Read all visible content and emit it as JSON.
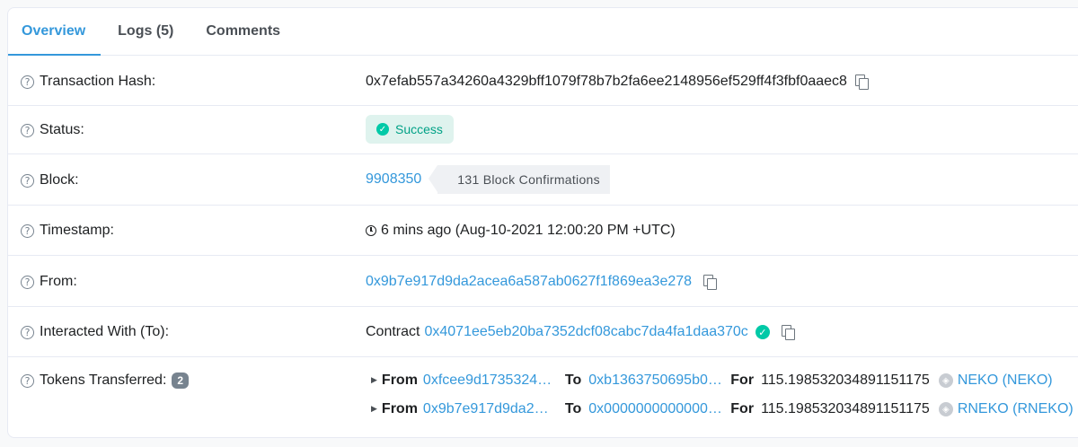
{
  "tabs": [
    {
      "label": "Overview",
      "active": true
    },
    {
      "label": "Logs (5)",
      "active": false
    },
    {
      "label": "Comments",
      "active": false
    }
  ],
  "rows": {
    "hash": {
      "label": "Transaction Hash:",
      "value": "0x7efab557a34260a4329bff1079f78b7b2fa6ee2148956ef529ff4f3fbf0aaec8"
    },
    "status": {
      "label": "Status:",
      "value": "Success"
    },
    "block": {
      "label": "Block:",
      "number": "9908350",
      "confirmations": "131 Block Confirmations"
    },
    "timestamp": {
      "label": "Timestamp:",
      "value": "6 mins ago (Aug-10-2021 12:00:20 PM +UTC)"
    },
    "from": {
      "label": "From:",
      "value": "0x9b7e917d9da2acea6a587ab0627f1f869ea3e278"
    },
    "interacted": {
      "label": "Interacted With (To):",
      "prefix": "Contract",
      "value": "0x4071ee5eb20ba7352dcf08cabc7da4fa1daa370c"
    },
    "tokens": {
      "label": "Tokens Transferred:",
      "count": "2",
      "from_label": "From",
      "to_label": "To",
      "for_label": "For",
      "transfers": [
        {
          "from": "0xfcee9d1735324…",
          "to": "0xb1363750695b0…",
          "amount": "115.198532034891151175",
          "token": "NEKO (NEKO)"
        },
        {
          "from": "0x9b7e917d9da2a…",
          "to": "0x0000000000000…",
          "amount": "115.198532034891151175",
          "token": "RNEKO (RNEKO)"
        }
      ]
    }
  },
  "colors": {
    "accent": "#3498db",
    "success": "#00c9a7",
    "text": "#1e2022",
    "muted": "#77838f"
  },
  "icons": [
    "question-icon",
    "copy-icon",
    "check-circle-icon",
    "clock-icon",
    "verified-icon",
    "caret-right-icon",
    "token-icon"
  ]
}
